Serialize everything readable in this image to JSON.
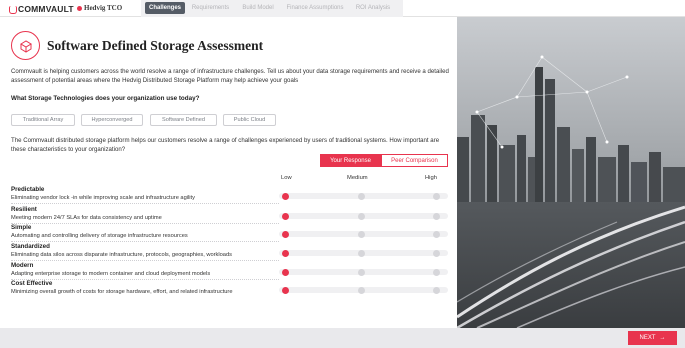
{
  "brand": {
    "logo": "COMMVAULT",
    "partner": "Hedvig TCO"
  },
  "nav": {
    "tabs": [
      {
        "label": "Challenges",
        "active": true
      },
      {
        "label": "Requirements",
        "active": false
      },
      {
        "label": "Build Model",
        "active": false
      },
      {
        "label": "Finance Assumptions",
        "active": false
      },
      {
        "label": "ROI Analysis",
        "active": false
      }
    ]
  },
  "page": {
    "title": "Software Defined Storage Assessment",
    "intro": "Commvault is helping customers across the world resolve a range of infrastructure challenges. Tell us about your data storage requirements and receive a detailed assessment of potential areas where the Hedvig Distributed Storage Platform may help achieve your goals",
    "question1": "What Storage Technologies does your organization use today?",
    "technologies": [
      "Traditional Array",
      "Hyperconverged",
      "Software Defined",
      "Public Cloud"
    ],
    "question2": "The Commvault distributed storage platform helps our customers resolve a range of challenges experienced by users of traditional systems. How important are these characteristics to your organization?",
    "response_buttons": {
      "primary": "Your Response",
      "secondary": "Peer Comparison"
    },
    "scale_labels": [
      "Low",
      "Medium",
      "High"
    ]
  },
  "characteristics": [
    {
      "title": "Predictable",
      "description": "Eliminating vendor lock -in while improving scale and infrastructure agility",
      "selected": "Low"
    },
    {
      "title": "Resilient",
      "description": "Meeting modern 24/7 SLAs for data consistency and uptime",
      "selected": "Low"
    },
    {
      "title": "Simple",
      "description": "Automating and controlling delivery of storage infrastructure resources",
      "selected": "Low"
    },
    {
      "title": "Standardized",
      "description": "Eliminating data silos across disparate infrastructure, protocols, geographies, workloads",
      "selected": "Low"
    },
    {
      "title": "Modern",
      "description": "Adapting enterprise storage to modern container and cloud deployment models",
      "selected": "Low"
    },
    {
      "title": "Cost Effective",
      "description": "Minimizing overall growth of costs for storage hardware, effort, and related infrastructure",
      "selected": "Low"
    }
  ],
  "footer": {
    "next_label": "NEXT"
  },
  "colors": {
    "accent": "#e8344e",
    "nav_active": "#555c66"
  },
  "icons": {
    "header": "storage-assessment-icon",
    "next": "arrow-right-icon"
  }
}
